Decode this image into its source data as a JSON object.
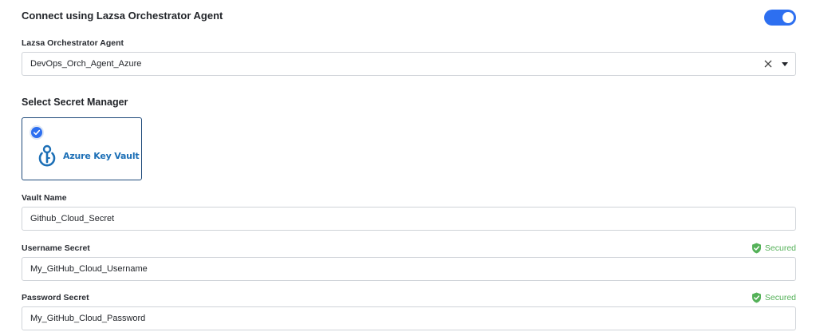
{
  "connect": {
    "title": "Connect using Lazsa Orchestrator Agent",
    "toggle_on": true
  },
  "agent": {
    "label": "Lazsa Orchestrator Agent",
    "value": "DevOps_Orch_Agent_Azure"
  },
  "secret_manager": {
    "title": "Select Secret Manager",
    "option_name": "Azure Key Vault",
    "selected": true
  },
  "vault_name": {
    "label": "Vault Name",
    "value": "Github_Cloud_Secret"
  },
  "username_secret": {
    "label": "Username Secret",
    "value": "My_GitHub_Cloud_Username",
    "status": "Secured"
  },
  "password_secret": {
    "label": "Password Secret",
    "value": "My_GitHub_Cloud_Password",
    "status": "Secured"
  },
  "colors": {
    "accent": "#2d6ff0",
    "secured": "#54b158",
    "vault_brand": "#1c6fb6"
  },
  "icons": {
    "clear": "close-icon",
    "dropdown": "chevron-down-icon",
    "check": "check-icon",
    "vault": "key-vault-icon",
    "secured": "shield-check-icon"
  }
}
